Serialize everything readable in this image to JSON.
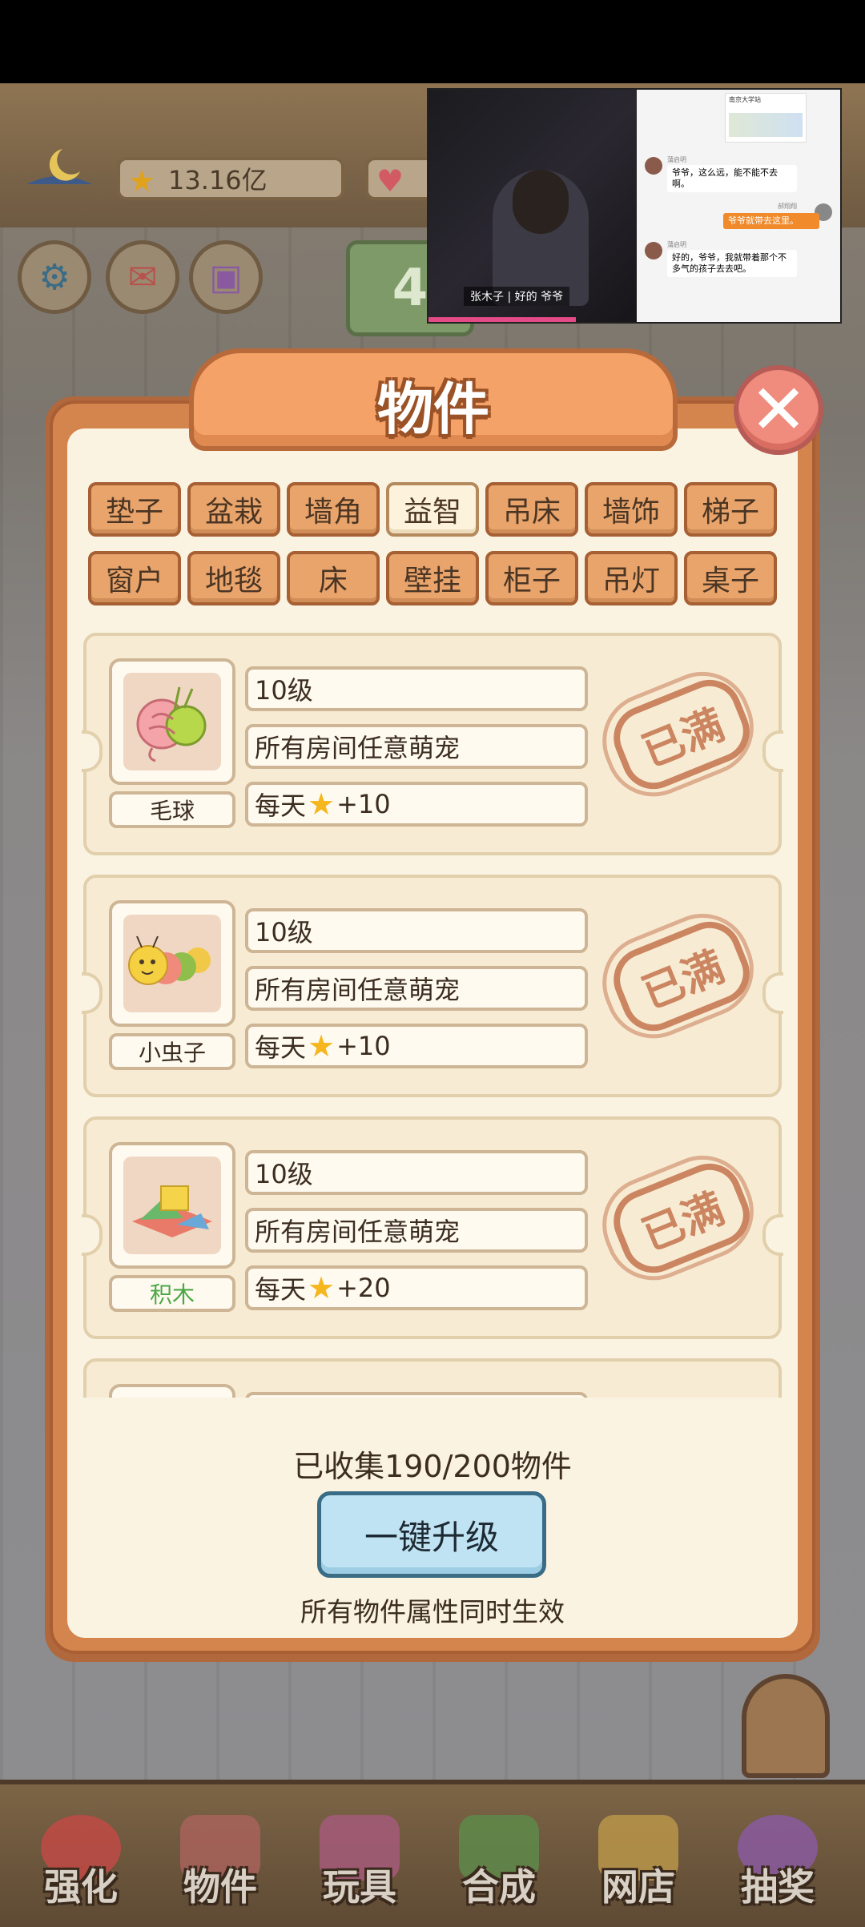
{
  "hud": {
    "stars_value": "13.16亿",
    "star_icon": "star-icon",
    "heart_icon": "heart-icon",
    "level_sign": "4"
  },
  "video_overlay": {
    "subtitle": "张木子 | 好的  爷爷",
    "chat_map_title": "南京大学站",
    "chat_messages": [
      {
        "name": "蒲启明",
        "text": "爷爷，这么远，能不能不去啊。",
        "side": "left"
      },
      {
        "name": "郝翔翔",
        "text": "爷爷就带去这里。",
        "side": "right"
      },
      {
        "name": "蒲启明",
        "text": "好的，爷爷，我就带着那个不多气的孩子去去吧。",
        "side": "left"
      }
    ]
  },
  "modal": {
    "title": "物件",
    "close_icon": "close-icon",
    "tabs_row1": [
      "垫子",
      "盆栽",
      "墙角",
      "益智",
      "吊床",
      "墙饰",
      "梯子"
    ],
    "tabs_row2": [
      "窗户",
      "地毯",
      "床",
      "壁挂",
      "柜子",
      "吊灯",
      "桌子"
    ],
    "active_tab": "益智",
    "items": [
      {
        "name": "毛球",
        "level": "10级",
        "scope": "所有房间任意萌宠",
        "reward_prefix": "每天",
        "reward_value": "+10",
        "status": "已满",
        "name_color": "default"
      },
      {
        "name": "小虫子",
        "level": "10级",
        "scope": "所有房间任意萌宠",
        "reward_prefix": "每天",
        "reward_value": "+10",
        "status": "已满",
        "name_color": "default"
      },
      {
        "name": "积木",
        "level": "10级",
        "scope": "所有房间任意萌宠",
        "reward_prefix": "每天",
        "reward_value": "+20",
        "status": "已满",
        "name_color": "#4aa746"
      }
    ],
    "collected_text": "已收集190/200物件",
    "upgrade_button": "一键升级",
    "note": "所有物件属性同时生效"
  },
  "bottom_nav": [
    {
      "label": "强化",
      "icon": "swirl-icon",
      "color": "#c04a45"
    },
    {
      "label": "物件",
      "icon": "piano-icon",
      "color": "#a8625a"
    },
    {
      "label": "玩具",
      "icon": "house-icon",
      "color": "#a45a7a"
    },
    {
      "label": "合成",
      "icon": "cards-icon",
      "color": "#5e8a4a"
    },
    {
      "label": "网店",
      "icon": "basket-icon",
      "color": "#b9954a"
    },
    {
      "label": "抽奖",
      "icon": "wheel-icon",
      "color": "#8a5aa0"
    }
  ],
  "colors": {
    "modal_frame": "#d4854e",
    "modal_inner": "#fbf3e2",
    "tab": "#e9a46c",
    "tab_active": "#fdf3dc",
    "upgrade_button": "#bfe3f3",
    "stamp": "#c77a55"
  }
}
